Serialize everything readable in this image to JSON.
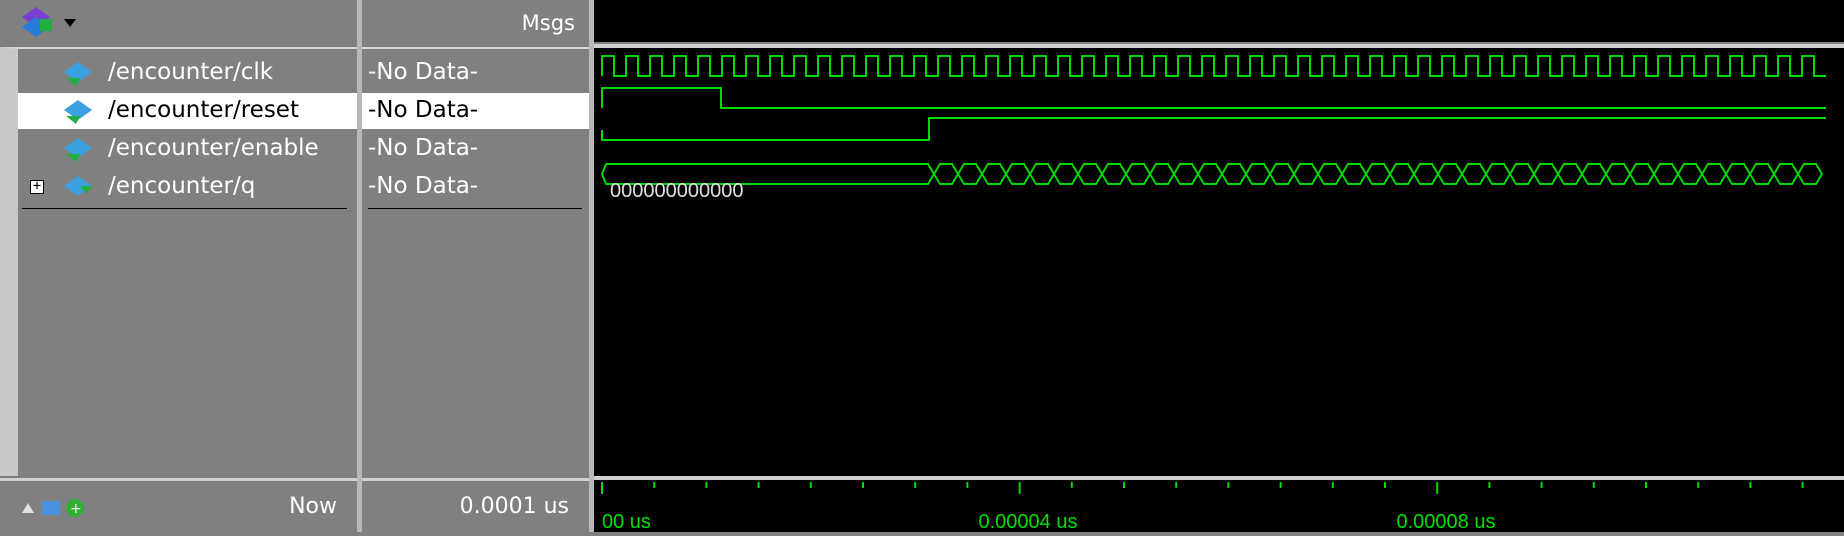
{
  "header": {
    "msgs_label": "Msgs",
    "toolbar_icon": "wave-tool-icon"
  },
  "signals": [
    {
      "name": "/encounter/clk",
      "value": "-No Data-"
    },
    {
      "name": "/encounter/reset",
      "value": "-No Data-"
    },
    {
      "name": "/encounter/enable",
      "value": "-No Data-"
    },
    {
      "name": "/encounter/q",
      "value": "-No Data-",
      "expandable": true,
      "bus_value": "000000000000"
    }
  ],
  "footer": {
    "now_label": "Now",
    "now_value": "0.0001 us"
  },
  "time_axis": {
    "labels": [
      "00 us",
      "0.00004 us",
      "0.00008 us"
    ]
  },
  "colors": {
    "wave": "#00d800",
    "background": "#000000",
    "panel": "#808080",
    "selected_row": "#ffffff"
  }
}
